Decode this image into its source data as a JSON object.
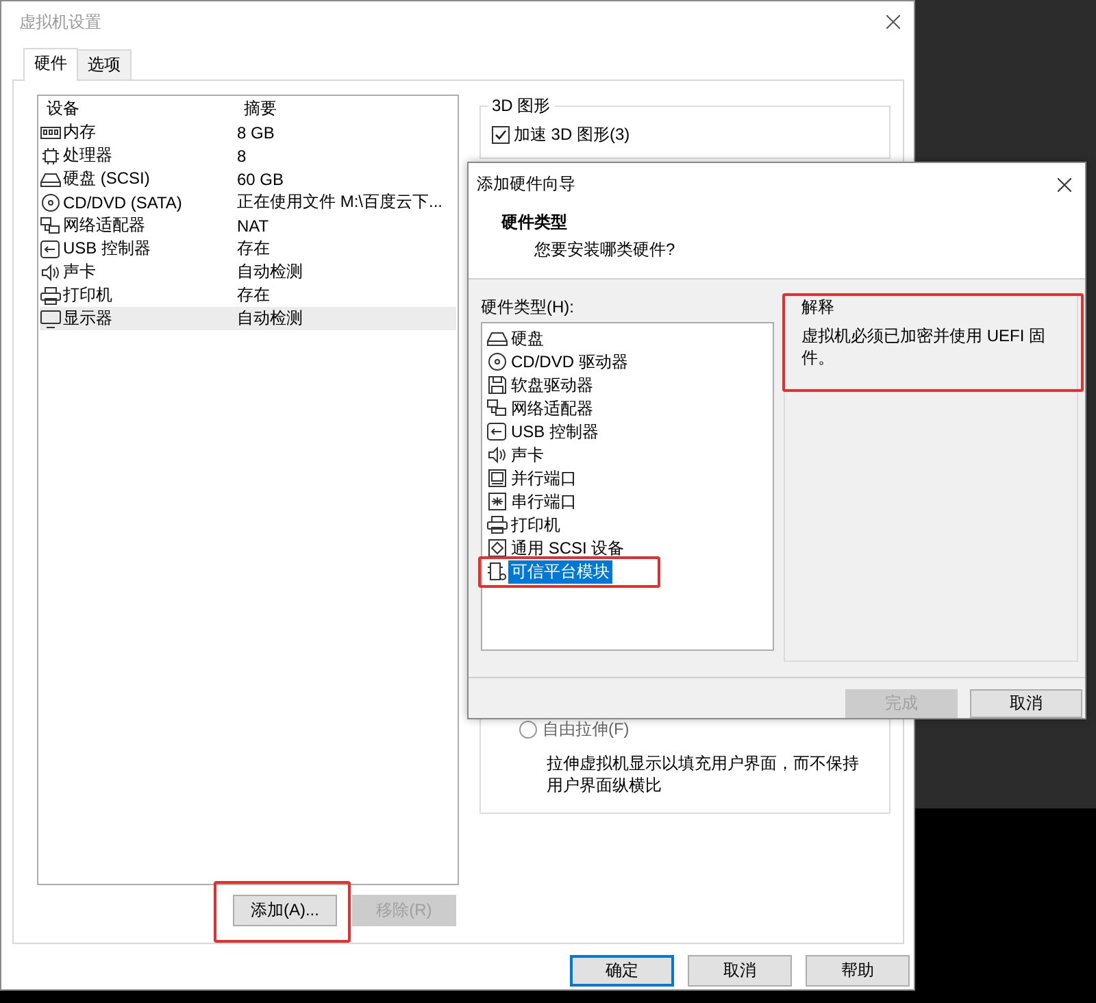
{
  "window": {
    "title": "虚拟机设置"
  },
  "tabs": [
    {
      "label": "硬件",
      "selected": true
    },
    {
      "label": "选项",
      "selected": false
    }
  ],
  "device_table": {
    "columns": [
      "设备",
      "摘要"
    ],
    "rows": [
      {
        "device": "内存",
        "summary": "8 GB",
        "selected": false
      },
      {
        "device": "处理器",
        "summary": "8",
        "selected": false
      },
      {
        "device": "硬盘 (SCSI)",
        "summary": "60 GB",
        "selected": false
      },
      {
        "device": "CD/DVD (SATA)",
        "summary": "正在使用文件 M:\\百度云下...",
        "selected": false
      },
      {
        "device": "网络适配器",
        "summary": "NAT",
        "selected": false
      },
      {
        "device": "USB 控制器",
        "summary": "存在",
        "selected": false
      },
      {
        "device": "声卡",
        "summary": "自动检测",
        "selected": false
      },
      {
        "device": "打印机",
        "summary": "存在",
        "selected": false
      },
      {
        "device": "显示器",
        "summary": "自动检测",
        "selected": true
      }
    ]
  },
  "device_buttons": [
    {
      "label": "添加(A)...",
      "disabled": false,
      "highlighted": true
    },
    {
      "label": "移除(R)",
      "disabled": true,
      "highlighted": false
    }
  ],
  "graphics_group": {
    "title": "3D 图形",
    "checkbox": {
      "label": "加速 3D 图形(3)",
      "checked": true
    }
  },
  "display_group": {
    "radio": {
      "label": "自由拉伸(F)",
      "selected": false
    },
    "description": "拉伸虚拟机显示以填充用户界面，而不保持用户界面纵横比"
  },
  "dialog_buttons": [
    {
      "label": "确定",
      "default": true
    },
    {
      "label": "取消",
      "default": false
    },
    {
      "label": "帮助",
      "default": false
    }
  ],
  "wizard": {
    "title": "添加硬件向导",
    "heading": "硬件类型",
    "subheading": "您要安装哪类硬件?",
    "list_label": "硬件类型(H):",
    "hardware_types": [
      {
        "label": "硬盘",
        "selected": false,
        "highlighted": false
      },
      {
        "label": "CD/DVD 驱动器",
        "selected": false,
        "highlighted": false
      },
      {
        "label": "软盘驱动器",
        "selected": false,
        "highlighted": false
      },
      {
        "label": "网络适配器",
        "selected": false,
        "highlighted": false
      },
      {
        "label": "USB 控制器",
        "selected": false,
        "highlighted": false
      },
      {
        "label": "声卡",
        "selected": false,
        "highlighted": false
      },
      {
        "label": "并行端口",
        "selected": false,
        "highlighted": false
      },
      {
        "label": "串行端口",
        "selected": false,
        "highlighted": false
      },
      {
        "label": "打印机",
        "selected": false,
        "highlighted": false
      },
      {
        "label": "通用 SCSI 设备",
        "selected": false,
        "highlighted": false
      },
      {
        "label": "可信平台模块",
        "selected": true,
        "highlighted": true
      }
    ],
    "explanation": {
      "title": "解释",
      "text": "虚拟机必须已加密并使用 UEFI 固件。",
      "highlighted": true
    },
    "buttons": [
      {
        "label": "完成",
        "disabled": true
      },
      {
        "label": "取消",
        "disabled": false
      }
    ]
  }
}
